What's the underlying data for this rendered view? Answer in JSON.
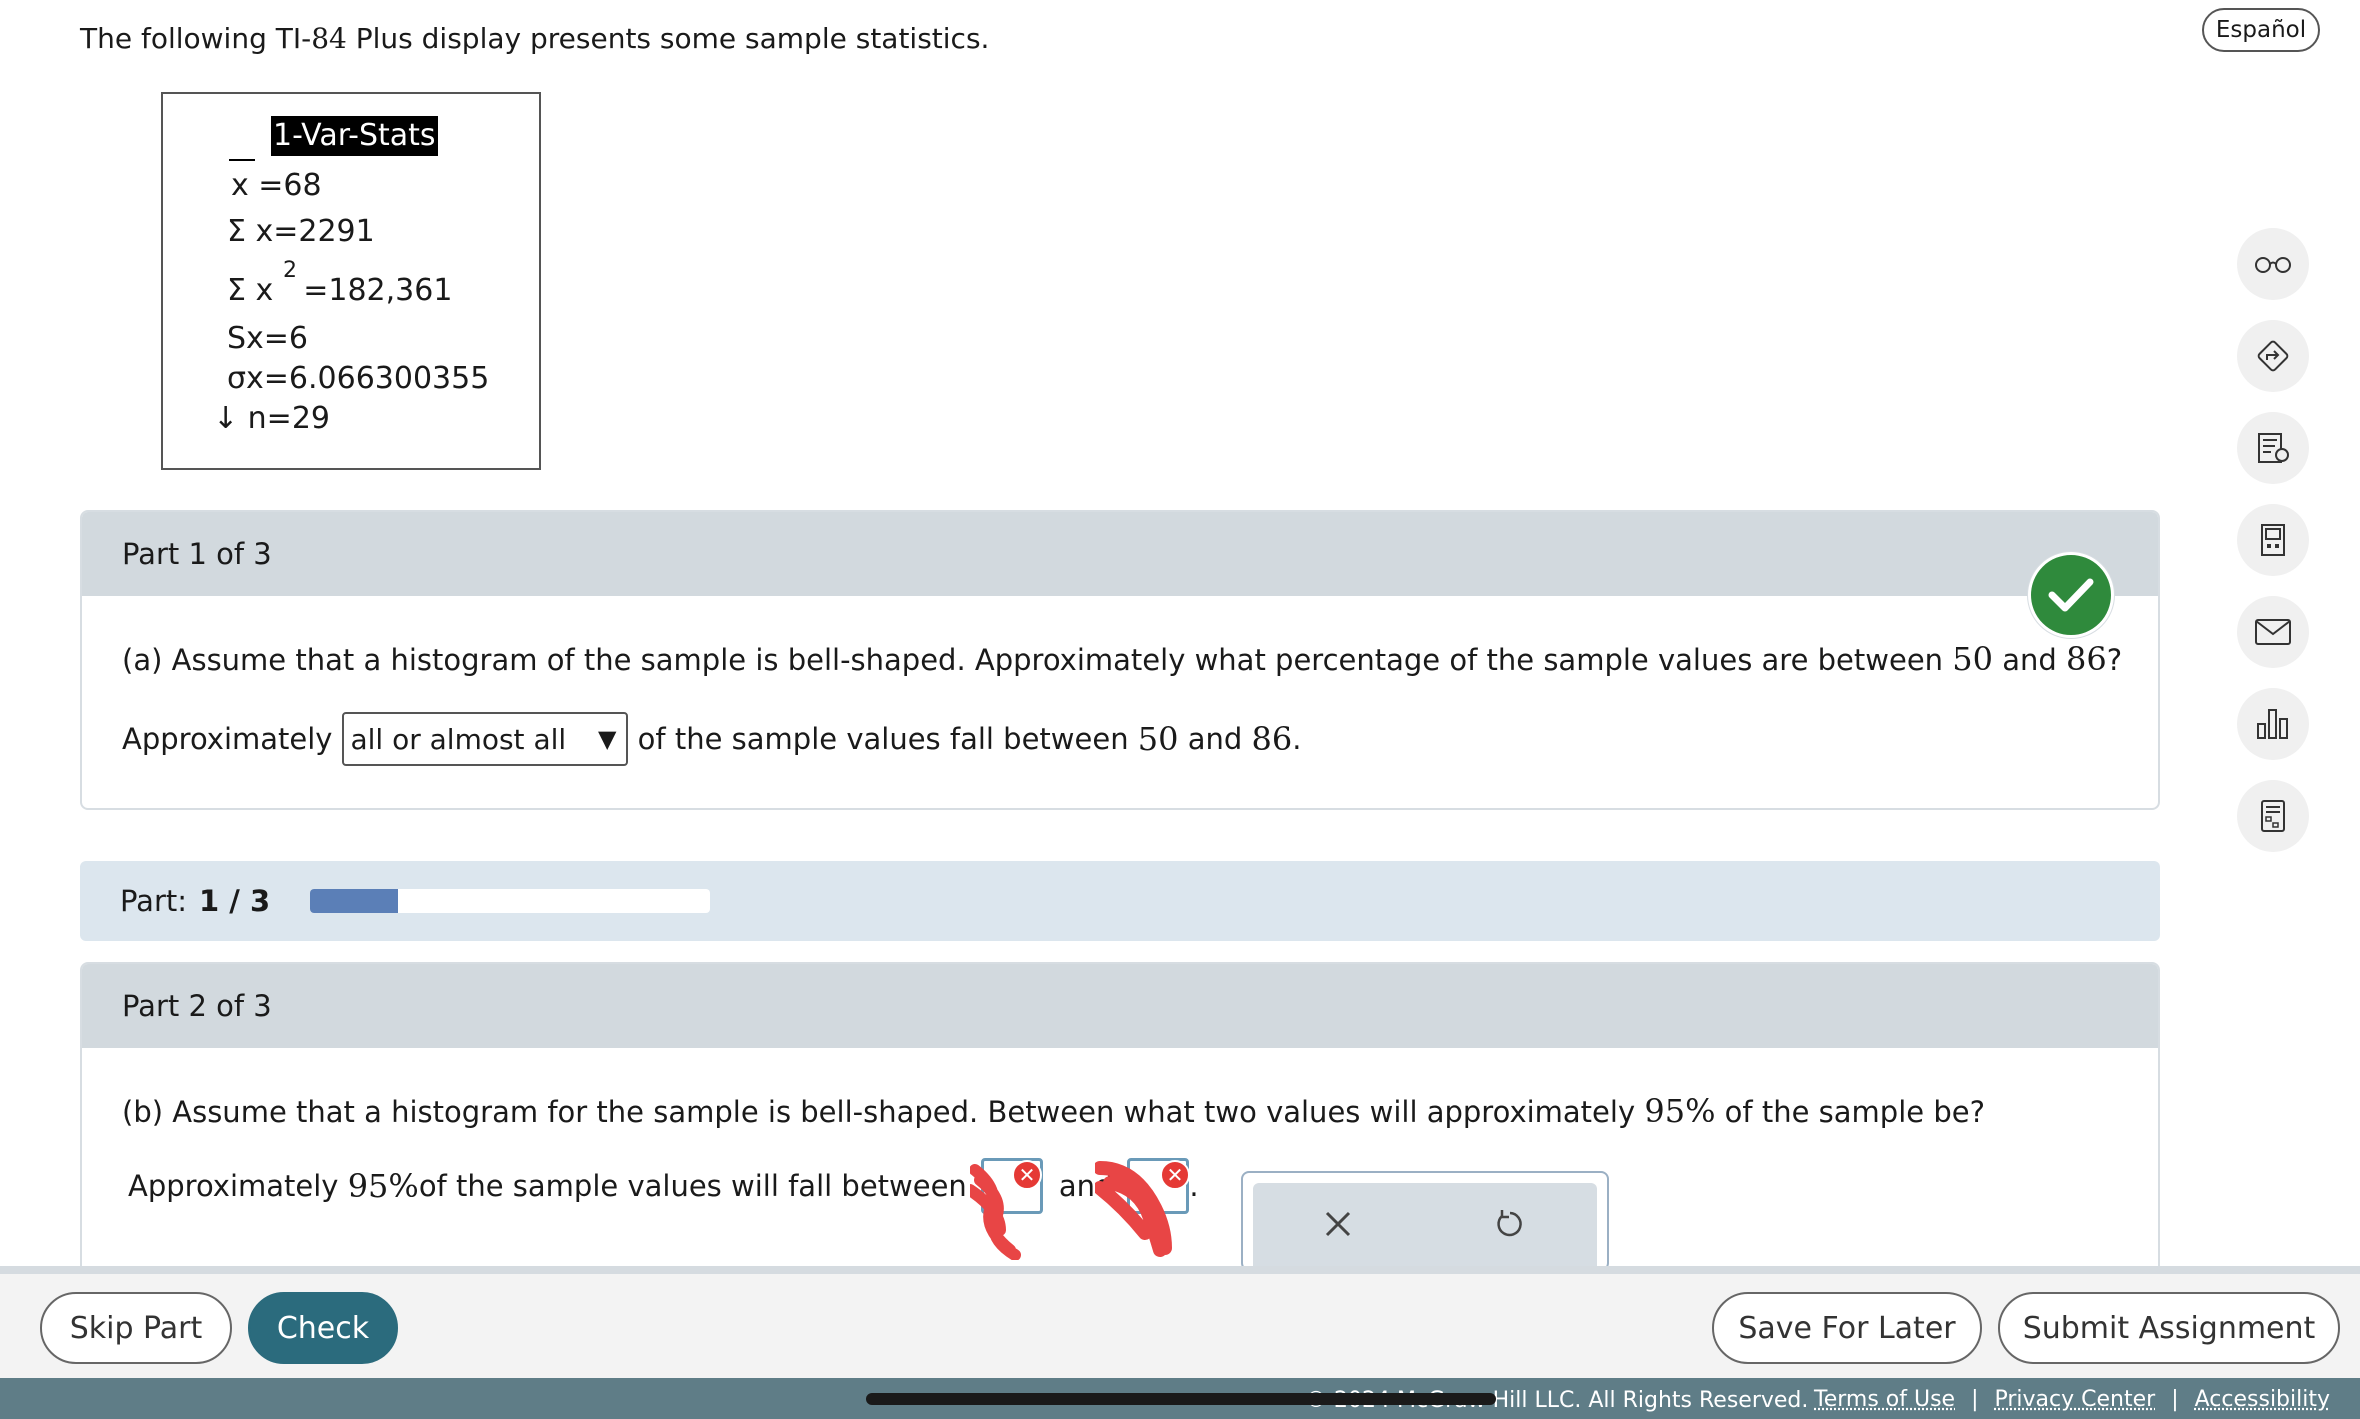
{
  "intro": {
    "text_a": "The following TI-",
    "text_num": "84",
    "text_b": " Plus display presents some sample statistics."
  },
  "language_button": "Español",
  "calculator": {
    "title": "1-Var-Stats",
    "xbar": "x =68",
    "sum_x": "Σ x=2291",
    "sum_x2_a": "Σ x",
    "sum_x2_sup": "2",
    "sum_x2_b": "=182,361",
    "sx": "Sx=6",
    "sigma_x": "σx=6.066300355",
    "n": "↓ n=29"
  },
  "sidebar": {
    "icons": [
      "glasses-icon",
      "navigate-icon",
      "hint-icon",
      "calculator-icon",
      "mail-icon",
      "chart-icon",
      "grade-icon"
    ]
  },
  "part1": {
    "header": "Part 1 of 3",
    "question_a": "(a) Assume that a histogram of the sample is bell-shaped. Approximately what percentage of the sample values are between ",
    "num1": "50",
    "question_and": " and ",
    "num2": "86",
    "question_end": "?",
    "answer_prefix": "Approximately",
    "dropdown_value": "all or almost all",
    "answer_suffix": " of the sample values fall between ",
    "answer_num1": "50",
    "answer_and": " and ",
    "answer_num2": "86",
    "answer_end": "."
  },
  "progress": {
    "label": "Part:",
    "value_text": "1 / 3",
    "fraction": 0.22
  },
  "part2": {
    "header": "Part 2 of 3",
    "question_a": "(b) Assume that a histogram for the sample is bell-shaped. Between what two values will approximately ",
    "pct": "95%",
    "question_b": " of the sample be?",
    "answer_prefix": "Approximately ",
    "answer_pct": "95%",
    "answer_mid": " of the sample values will fall between",
    "and_text": "and",
    "end": "."
  },
  "buttons": {
    "skip": "Skip Part",
    "check": "Check",
    "save": "Save For Later",
    "submit": "Submit Assignment"
  },
  "footer": {
    "copyright": "© 2024 McGraw Hill LLC. All Rights Reserved.",
    "terms": "Terms of Use",
    "privacy": "Privacy Center",
    "accessibility": "Accessibility"
  },
  "colors": {
    "accent": "#2b6b7d",
    "progress_fill": "#5b7fb7",
    "correct": "#2f8a3c",
    "error": "#e53935"
  }
}
